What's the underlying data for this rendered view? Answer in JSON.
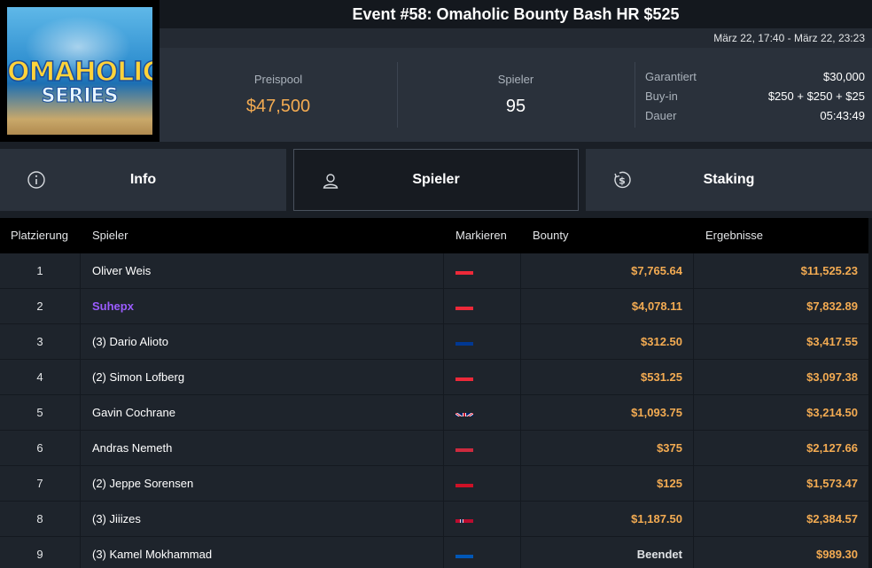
{
  "event": {
    "title": "Event #58: Omaholic Bounty Bash HR $525",
    "dates": "März 22, 17:40 - März 22, 23:23",
    "logo_line1": "OMAHOLIC",
    "logo_line2": "SERIES"
  },
  "stats": {
    "prizepool_label": "Preispool",
    "prizepool_value": "$47,500",
    "players_label": "Spieler",
    "players_value": "95",
    "guaranteed_label": "Garantiert",
    "guaranteed_value": "$30,000",
    "buyin_label": "Buy-in",
    "buyin_value": "$250 + $250 + $25",
    "duration_label": "Dauer",
    "duration_value": "05:43:49"
  },
  "tabs": [
    {
      "label": "Info",
      "icon": "info-icon"
    },
    {
      "label": "Spieler",
      "icon": "user-icon",
      "active": true
    },
    {
      "label": "Staking",
      "icon": "dollar-coin-icon"
    }
  ],
  "table": {
    "headers": {
      "place": "Platzierung",
      "player": "Spieler",
      "flag": "Markieren",
      "bounty": "Bounty",
      "result": "Ergebnisse"
    },
    "rows": [
      {
        "place": "1",
        "player": "Oliver Weis",
        "flag": "austria",
        "bounty": "$7,765.64",
        "result": "$11,525.23"
      },
      {
        "place": "2",
        "player": "Suhepx",
        "flag": "austria",
        "bounty": "$4,078.11",
        "result": "$7,832.89",
        "highlight": true
      },
      {
        "place": "3",
        "player": "(3) Dario Alioto",
        "flag": "cape-verde",
        "bounty": "$312.50",
        "result": "$3,417.55"
      },
      {
        "place": "4",
        "player": "(2) Simon Lofberg",
        "flag": "austria",
        "bounty": "$531.25",
        "result": "$3,097.38"
      },
      {
        "place": "5",
        "player": "Gavin Cochrane",
        "flag": "united-kingdom",
        "bounty": "$1,093.75",
        "result": "$3,214.50"
      },
      {
        "place": "6",
        "player": "Andras Nemeth",
        "flag": "hungary",
        "bounty": "$375",
        "result": "$2,127.66"
      },
      {
        "place": "7",
        "player": "(2) Jeppe Sorensen",
        "flag": "monaco",
        "bounty": "$125",
        "result": "$1,573.47"
      },
      {
        "place": "8",
        "player": "(3) Jiiizes",
        "flag": "norway",
        "bounty": "$1,187.50",
        "result": "$2,384.57"
      },
      {
        "place": "9",
        "player": "(3) Kamel Mokhammad",
        "flag": "ukraine",
        "bounty": "Beendet",
        "result": "$989.30",
        "ended": true
      }
    ]
  },
  "colors": {
    "accent": "#f3ab52",
    "highlight_player": "#9b5cff",
    "panel": "#2a313b",
    "background": "#1a1f26"
  }
}
